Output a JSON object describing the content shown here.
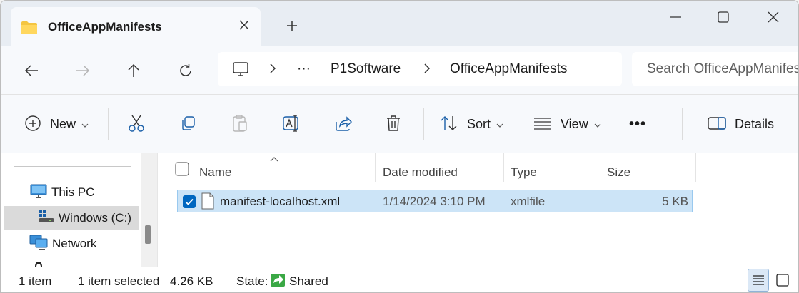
{
  "tab": {
    "title": "OfficeAppManifests"
  },
  "address": {
    "ellipsis": "···",
    "crumbs": [
      "P1Software",
      "OfficeAppManifests"
    ]
  },
  "search": {
    "placeholder": "Search OfficeAppManifests"
  },
  "toolbar": {
    "new_label": "New",
    "sort_label": "Sort",
    "view_label": "View",
    "more_label": "•••",
    "details_label": "Details"
  },
  "sidebar": {
    "items": [
      {
        "label": "This PC",
        "icon": "monitor-icon"
      },
      {
        "label": "Windows (C:)",
        "icon": "drive-icon",
        "selected": true
      },
      {
        "label": "Network",
        "icon": "network-icon"
      }
    ]
  },
  "columns": {
    "name": "Name",
    "date_modified": "Date modified",
    "type": "Type",
    "size": "Size"
  },
  "files": [
    {
      "name": "manifest-localhost.xml",
      "date_modified": "1/14/2024 3:10 PM",
      "type": "xmlfile",
      "size": "5 KB",
      "selected": true
    }
  ],
  "status": {
    "count": "1 item",
    "selected": "1 item selected",
    "selected_size": "4.26 KB",
    "state_label": "State:",
    "state_value": "Shared"
  },
  "colors": {
    "accent": "#0067c0",
    "selection": "#cce4f7",
    "folder": "#f4c542"
  }
}
